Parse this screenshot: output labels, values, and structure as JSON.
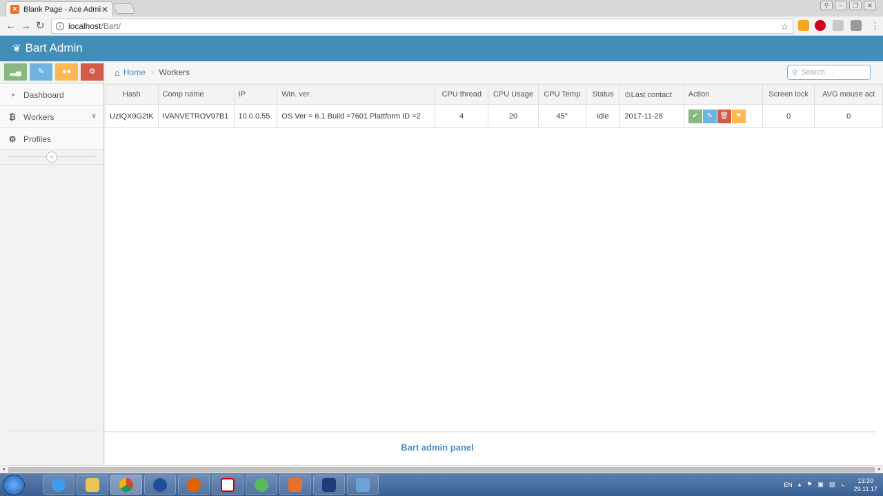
{
  "browser": {
    "tab_title": "Blank Page - Ace Admin",
    "tab_close": "✕",
    "url_host": "localhost",
    "url_path": "/Bart/"
  },
  "app": {
    "brand": "Bart Admin"
  },
  "sidebar": {
    "items": [
      {
        "label": "Dashboard",
        "icon": "dashboard-icon"
      },
      {
        "label": "Workers",
        "icon": "bitcoin-icon"
      },
      {
        "label": "Profiles",
        "icon": "cogs-icon"
      }
    ]
  },
  "breadcrumb": {
    "home": "Home",
    "current": "Workers"
  },
  "search": {
    "placeholder": "Search ..."
  },
  "table": {
    "headers": [
      "Hash",
      "Comp name",
      "IP",
      "Win. ver.",
      "CPU thread",
      "CPU Usage",
      "CPU Temp",
      "Status",
      "Last contact",
      "Action",
      "Screen lock",
      "AVG mouse act"
    ],
    "rows": [
      {
        "hash": "UzIQX9G2tK",
        "comp_name": "IVANVETROV97B1",
        "ip": "10.0.0.55",
        "win_ver": "OS Ver = 6.1 Build =7601 Plattform ID =2",
        "cpu_thread": "4",
        "cpu_usage": "20",
        "cpu_temp": "45°",
        "status": "idle",
        "last_contact": "2017-11-28",
        "screen_lock": "0",
        "avg_mouse_act": "0"
      }
    ]
  },
  "footer": {
    "text": "Bart admin panel"
  },
  "taskbar": {
    "lang": "EN",
    "time": "13:30",
    "date": "29.11.17"
  },
  "colors": {
    "navbar": "#438eb9",
    "green": "#87b87f",
    "blue": "#6fb3e0",
    "orange": "#ffb752",
    "red": "#d15b47"
  }
}
